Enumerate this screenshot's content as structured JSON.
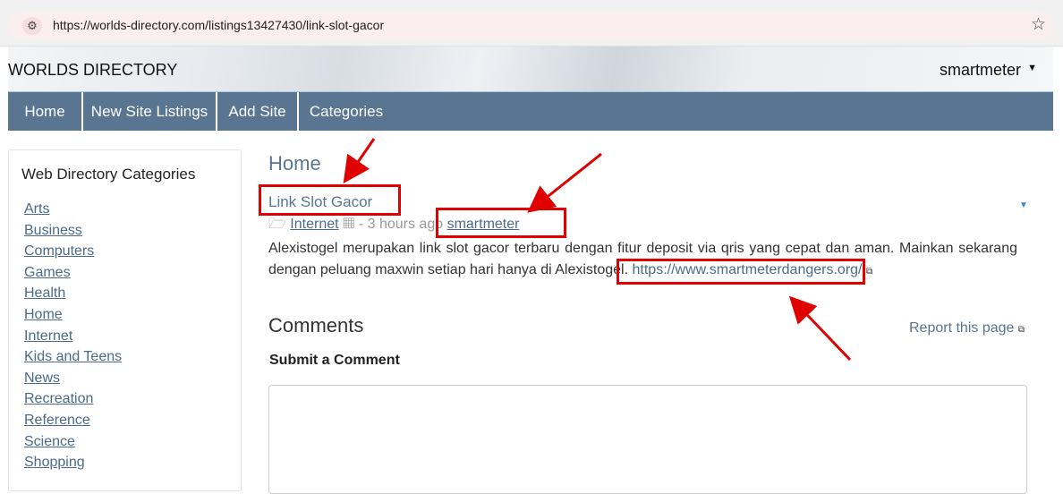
{
  "browser": {
    "url": "https://worlds-directory.com/listings13427430/link-slot-gacor",
    "site_info_icon": "tune-icon",
    "star_icon": "star-icon"
  },
  "header": {
    "site_title": "WORLDS DIRECTORY",
    "user": "smartmeter"
  },
  "nav": {
    "items": [
      "Home",
      "New Site Listings",
      "Add Site",
      "Categories"
    ]
  },
  "sidebar": {
    "title": "Web Directory Categories",
    "categories": [
      "Arts",
      "Business",
      "Computers",
      "Games",
      "Health",
      "Home",
      "Internet",
      "Kids and Teens",
      "News",
      "Recreation",
      "Reference",
      "Science",
      "Shopping"
    ]
  },
  "main": {
    "title": "Home",
    "listing": {
      "title": "Link Slot Gacor",
      "category": "Internet",
      "time": "- 3 hours ago",
      "author": "smartmeter",
      "description": "Alexistogel merupakan link slot gacor terbaru dengan fitur deposit via qris yang cepat dan aman. Mainkan sekarang dengan peluang maxwin setiap hari hanya di Alexistogel.",
      "link": "https://www.smartmeterdangers.org/"
    },
    "comments_title": "Comments",
    "report": "Report this page",
    "submit_label": "Submit a Comment"
  },
  "colors": {
    "nav_bg": "#5a7592",
    "annotation": "#e00000"
  }
}
